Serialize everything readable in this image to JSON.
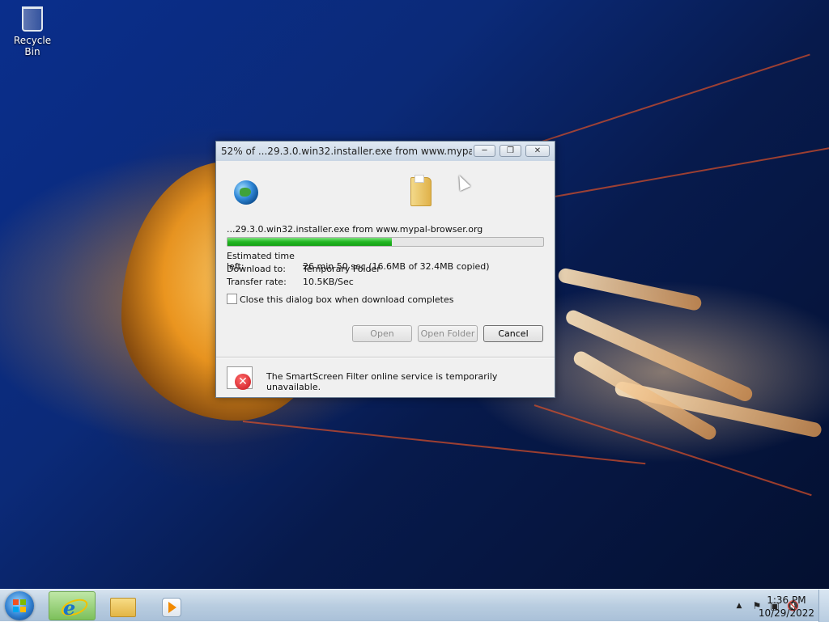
{
  "desktop": {
    "icons": [
      {
        "label": "Recycle Bin",
        "icon": "recycle-bin-icon"
      }
    ]
  },
  "dialog": {
    "title": "52% of ...29.3.0.win32.installer.exe from www.mypal-bro...",
    "filename": "...29.3.0.win32.installer.exe from www.mypal-browser.org",
    "progress_percent": 52,
    "estimated_label": "Estimated time left:",
    "estimated_value": "26 min 50 sec (16.6MB of 32.4MB copied)",
    "download_to_label": "Download to:",
    "download_to_value": "Temporary Folder",
    "rate_label": "Transfer rate:",
    "rate_value": "10.5KB/Sec",
    "close_checkbox_label": "Close this dialog box when download completes",
    "close_checkbox_checked": false,
    "buttons": {
      "open": "Open",
      "open_folder": "Open Folder",
      "cancel": "Cancel"
    },
    "smartscreen_message": "The SmartScreen Filter online service is temporarily unavailable."
  },
  "taskbar": {
    "items": [
      "internet-explorer-icon",
      "windows-explorer-icon",
      "media-player-icon"
    ],
    "clock_time": "1:36 PM",
    "clock_date": "10/29/2022"
  },
  "colors": {
    "progress_green": "#22b722",
    "desktop_blue": "#0a2e8c"
  }
}
